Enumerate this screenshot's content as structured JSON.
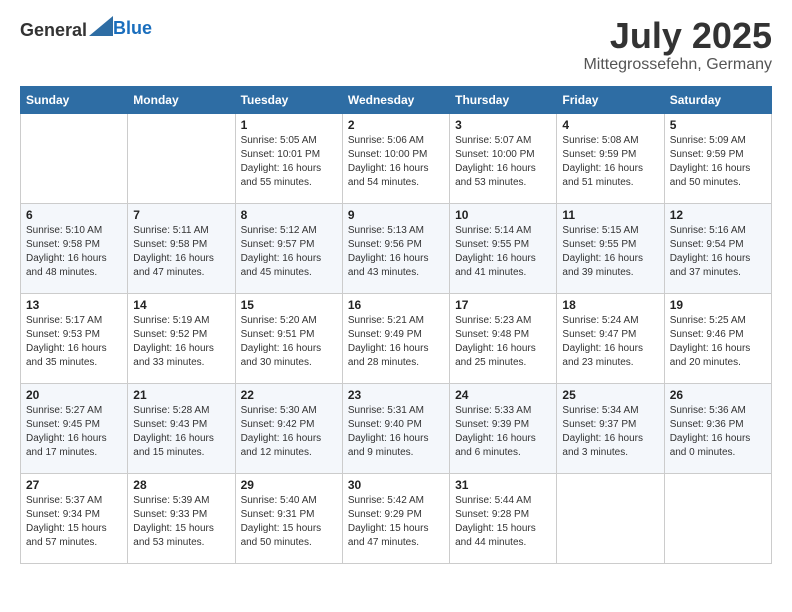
{
  "header": {
    "logo_general": "General",
    "logo_blue": "Blue",
    "month": "July 2025",
    "location": "Mittegrossefehn, Germany"
  },
  "weekdays": [
    "Sunday",
    "Monday",
    "Tuesday",
    "Wednesday",
    "Thursday",
    "Friday",
    "Saturday"
  ],
  "weeks": [
    [
      {
        "day": "",
        "info": ""
      },
      {
        "day": "",
        "info": ""
      },
      {
        "day": "1",
        "info": "Sunrise: 5:05 AM\nSunset: 10:01 PM\nDaylight: 16 hours and 55 minutes."
      },
      {
        "day": "2",
        "info": "Sunrise: 5:06 AM\nSunset: 10:00 PM\nDaylight: 16 hours and 54 minutes."
      },
      {
        "day": "3",
        "info": "Sunrise: 5:07 AM\nSunset: 10:00 PM\nDaylight: 16 hours and 53 minutes."
      },
      {
        "day": "4",
        "info": "Sunrise: 5:08 AM\nSunset: 9:59 PM\nDaylight: 16 hours and 51 minutes."
      },
      {
        "day": "5",
        "info": "Sunrise: 5:09 AM\nSunset: 9:59 PM\nDaylight: 16 hours and 50 minutes."
      }
    ],
    [
      {
        "day": "6",
        "info": "Sunrise: 5:10 AM\nSunset: 9:58 PM\nDaylight: 16 hours and 48 minutes."
      },
      {
        "day": "7",
        "info": "Sunrise: 5:11 AM\nSunset: 9:58 PM\nDaylight: 16 hours and 47 minutes."
      },
      {
        "day": "8",
        "info": "Sunrise: 5:12 AM\nSunset: 9:57 PM\nDaylight: 16 hours and 45 minutes."
      },
      {
        "day": "9",
        "info": "Sunrise: 5:13 AM\nSunset: 9:56 PM\nDaylight: 16 hours and 43 minutes."
      },
      {
        "day": "10",
        "info": "Sunrise: 5:14 AM\nSunset: 9:55 PM\nDaylight: 16 hours and 41 minutes."
      },
      {
        "day": "11",
        "info": "Sunrise: 5:15 AM\nSunset: 9:55 PM\nDaylight: 16 hours and 39 minutes."
      },
      {
        "day": "12",
        "info": "Sunrise: 5:16 AM\nSunset: 9:54 PM\nDaylight: 16 hours and 37 minutes."
      }
    ],
    [
      {
        "day": "13",
        "info": "Sunrise: 5:17 AM\nSunset: 9:53 PM\nDaylight: 16 hours and 35 minutes."
      },
      {
        "day": "14",
        "info": "Sunrise: 5:19 AM\nSunset: 9:52 PM\nDaylight: 16 hours and 33 minutes."
      },
      {
        "day": "15",
        "info": "Sunrise: 5:20 AM\nSunset: 9:51 PM\nDaylight: 16 hours and 30 minutes."
      },
      {
        "day": "16",
        "info": "Sunrise: 5:21 AM\nSunset: 9:49 PM\nDaylight: 16 hours and 28 minutes."
      },
      {
        "day": "17",
        "info": "Sunrise: 5:23 AM\nSunset: 9:48 PM\nDaylight: 16 hours and 25 minutes."
      },
      {
        "day": "18",
        "info": "Sunrise: 5:24 AM\nSunset: 9:47 PM\nDaylight: 16 hours and 23 minutes."
      },
      {
        "day": "19",
        "info": "Sunrise: 5:25 AM\nSunset: 9:46 PM\nDaylight: 16 hours and 20 minutes."
      }
    ],
    [
      {
        "day": "20",
        "info": "Sunrise: 5:27 AM\nSunset: 9:45 PM\nDaylight: 16 hours and 17 minutes."
      },
      {
        "day": "21",
        "info": "Sunrise: 5:28 AM\nSunset: 9:43 PM\nDaylight: 16 hours and 15 minutes."
      },
      {
        "day": "22",
        "info": "Sunrise: 5:30 AM\nSunset: 9:42 PM\nDaylight: 16 hours and 12 minutes."
      },
      {
        "day": "23",
        "info": "Sunrise: 5:31 AM\nSunset: 9:40 PM\nDaylight: 16 hours and 9 minutes."
      },
      {
        "day": "24",
        "info": "Sunrise: 5:33 AM\nSunset: 9:39 PM\nDaylight: 16 hours and 6 minutes."
      },
      {
        "day": "25",
        "info": "Sunrise: 5:34 AM\nSunset: 9:37 PM\nDaylight: 16 hours and 3 minutes."
      },
      {
        "day": "26",
        "info": "Sunrise: 5:36 AM\nSunset: 9:36 PM\nDaylight: 16 hours and 0 minutes."
      }
    ],
    [
      {
        "day": "27",
        "info": "Sunrise: 5:37 AM\nSunset: 9:34 PM\nDaylight: 15 hours and 57 minutes."
      },
      {
        "day": "28",
        "info": "Sunrise: 5:39 AM\nSunset: 9:33 PM\nDaylight: 15 hours and 53 minutes."
      },
      {
        "day": "29",
        "info": "Sunrise: 5:40 AM\nSunset: 9:31 PM\nDaylight: 15 hours and 50 minutes."
      },
      {
        "day": "30",
        "info": "Sunrise: 5:42 AM\nSunset: 9:29 PM\nDaylight: 15 hours and 47 minutes."
      },
      {
        "day": "31",
        "info": "Sunrise: 5:44 AM\nSunset: 9:28 PM\nDaylight: 15 hours and 44 minutes."
      },
      {
        "day": "",
        "info": ""
      },
      {
        "day": "",
        "info": ""
      }
    ]
  ]
}
